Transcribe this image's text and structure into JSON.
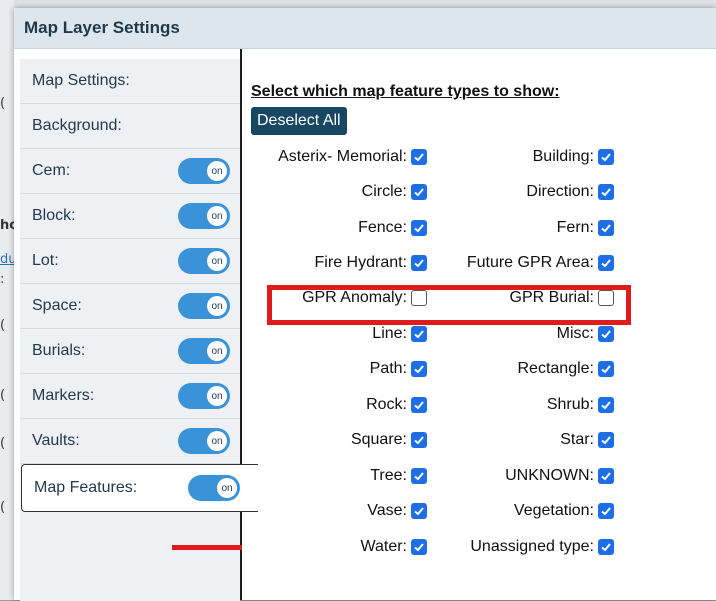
{
  "modal": {
    "title": "Map Layer Settings"
  },
  "layers": [
    {
      "label": "Map Settings:",
      "toggle": null
    },
    {
      "label": "Background:",
      "toggle": null
    },
    {
      "label": "Cem:",
      "toggle": "on"
    },
    {
      "label": "Block:",
      "toggle": "on"
    },
    {
      "label": "Lot:",
      "toggle": "on"
    },
    {
      "label": "Space:",
      "toggle": "on"
    },
    {
      "label": "Burials:",
      "toggle": "on"
    },
    {
      "label": "Markers:",
      "toggle": "on"
    },
    {
      "label": "Vaults:",
      "toggle": "on"
    },
    {
      "label": "Map Features:",
      "toggle": "on"
    }
  ],
  "features": {
    "heading": "Select which map feature types to show:",
    "deselect_label": "Deselect All",
    "items": [
      {
        "label": "Asterix- Memorial:",
        "checked": true
      },
      {
        "label": "Building:",
        "checked": true
      },
      {
        "label": "Circle:",
        "checked": true
      },
      {
        "label": "Direction:",
        "checked": true
      },
      {
        "label": "Fence:",
        "checked": true
      },
      {
        "label": "Fern:",
        "checked": true
      },
      {
        "label": "Fire Hydrant:",
        "checked": true
      },
      {
        "label": "Future GPR Area:",
        "checked": true
      },
      {
        "label": "GPR Anomaly:",
        "checked": false
      },
      {
        "label": "GPR Burial:",
        "checked": false
      },
      {
        "label": "Line:",
        "checked": true
      },
      {
        "label": "Misc:",
        "checked": true
      },
      {
        "label": "Path:",
        "checked": true
      },
      {
        "label": "Rectangle:",
        "checked": true
      },
      {
        "label": "Rock:",
        "checked": true
      },
      {
        "label": "Shrub:",
        "checked": true
      },
      {
        "label": "Square:",
        "checked": true
      },
      {
        "label": "Star:",
        "checked": true
      },
      {
        "label": "Tree:",
        "checked": true
      },
      {
        "label": "UNKNOWN:",
        "checked": true
      },
      {
        "label": "Vase:",
        "checked": true
      },
      {
        "label": "Vegetation:",
        "checked": true
      },
      {
        "label": "Water:",
        "checked": true
      },
      {
        "label": "Unassigned type:",
        "checked": true
      }
    ]
  },
  "background_fragments": [
    "(",
    "ho",
    "du",
    ":",
    "(",
    "(",
    "(",
    "("
  ],
  "colors": {
    "toggle_on": "#3a93d8",
    "checkbox_on": "#1e6fe6",
    "highlight": "#e01b1b",
    "header_bg": "#dce6ec",
    "button_bg": "#174763"
  }
}
